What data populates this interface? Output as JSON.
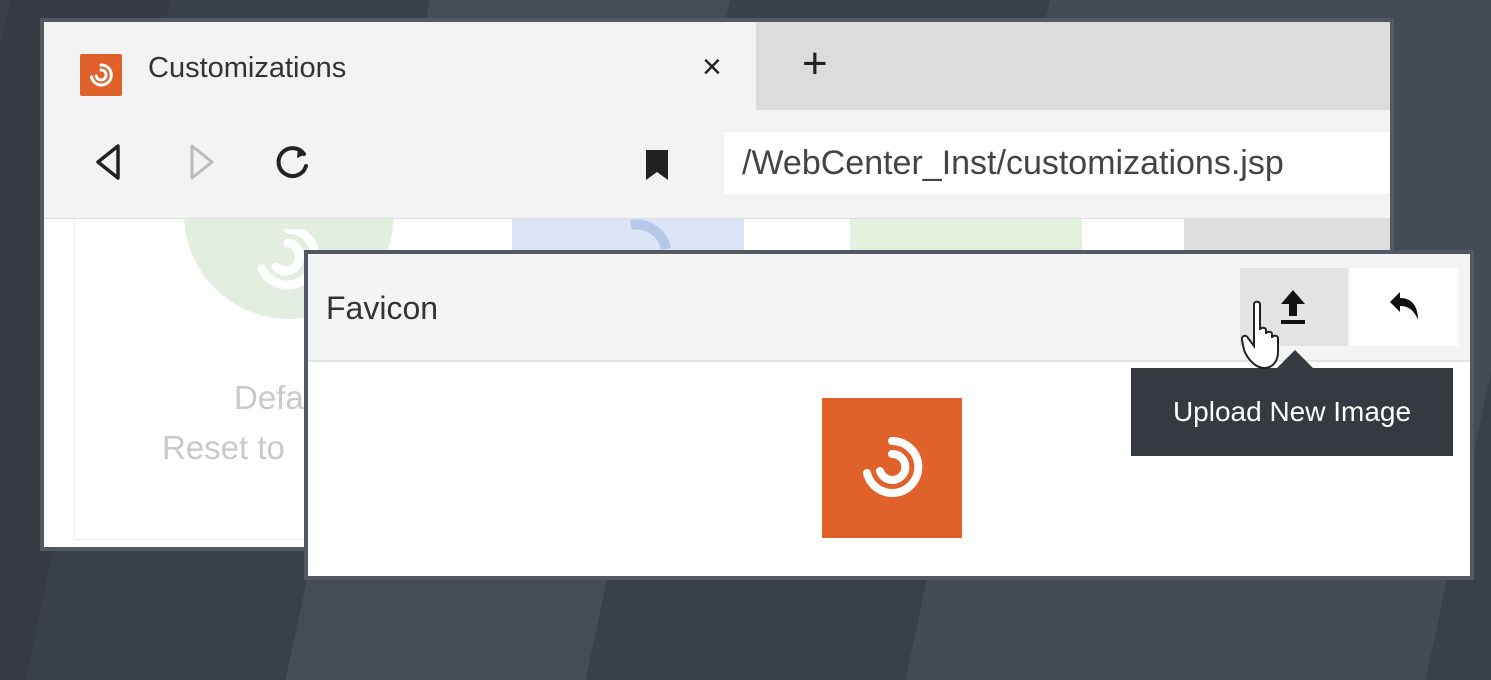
{
  "browser": {
    "tab": {
      "title": "Customizations",
      "close_glyph": "×",
      "favicon_icon": "spiral-logo-icon"
    },
    "new_tab_glyph": "+",
    "url": "/WebCenter_Inst/customizations.jsp",
    "nav_icons": [
      "back-icon",
      "forward-icon",
      "reload-icon",
      "bookmark-icon"
    ]
  },
  "page": {
    "card_label": "Defa",
    "card_sublabel": "Reset to"
  },
  "dialog": {
    "title": "Favicon",
    "upload_icon": "upload-icon",
    "revert_icon": "undo-icon"
  },
  "tooltip": {
    "text": "Upload New Image"
  },
  "colors": {
    "brand": "#e0612a",
    "tooltip_bg": "#343a40",
    "window_border": "#515963"
  }
}
